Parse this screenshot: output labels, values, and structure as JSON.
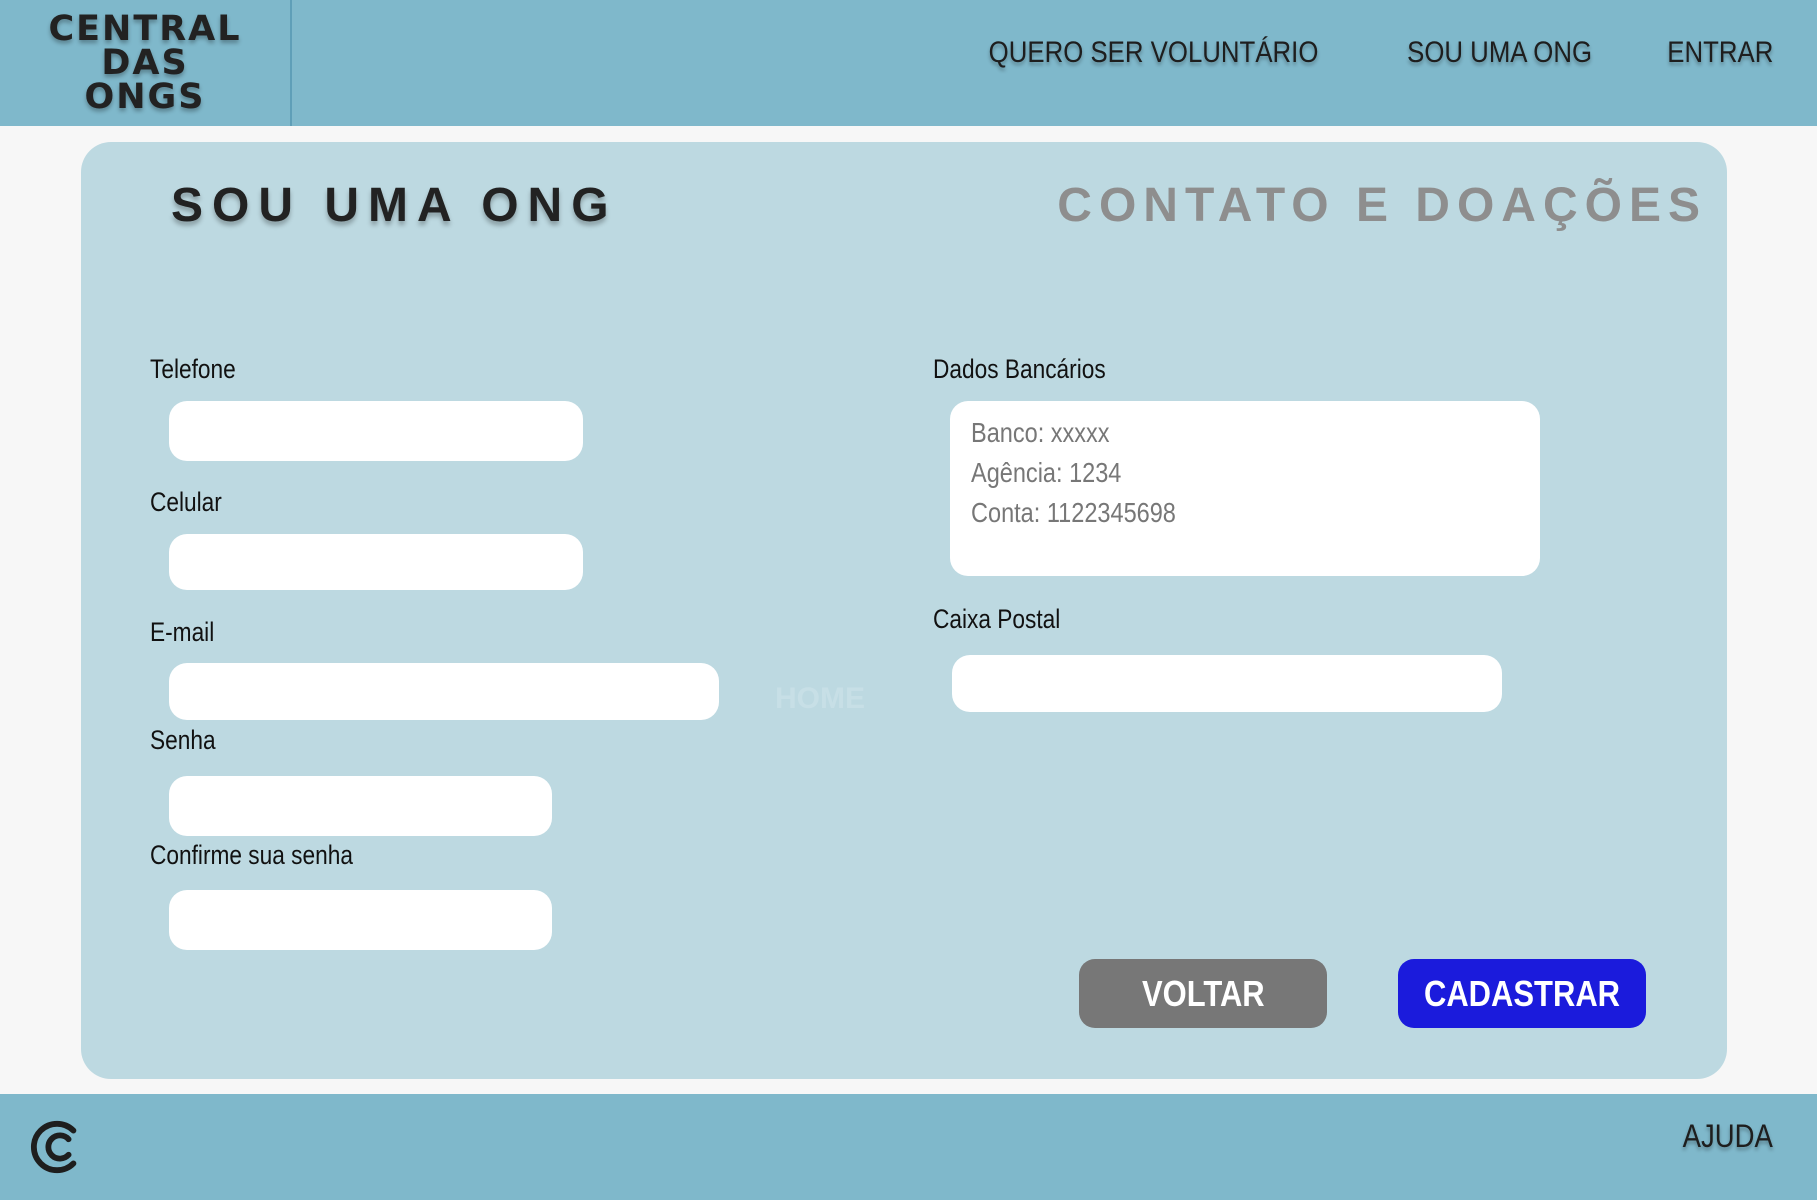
{
  "brand": {
    "logo_line1": "CENTRAL",
    "logo_line2": "DAS",
    "logo_line3": "ONGS"
  },
  "nav": {
    "volunteer": "QUERO SER VOLUNTÁRIO",
    "ngo": "SOU UMA ONG",
    "login": "ENTRAR"
  },
  "tabs": {
    "active": "SOU UMA ONG",
    "inactive": "CONTATO E DOAÇÕES"
  },
  "form": {
    "telefone_label": "Telefone",
    "celular_label": "Celular",
    "email_label": "E-mail",
    "senha_label": "Senha",
    "confirm_label": "Confirme sua senha",
    "bank_label": "Dados Bancários",
    "bank_line1": "Banco: xxxxx",
    "bank_line2": "Agência: 1234",
    "bank_line3": "Conta: 1122345698",
    "postal_label": "Caixa Postal",
    "ghost_text": "HOME"
  },
  "buttons": {
    "back": "VOLTAR",
    "submit": "CADASTRAR"
  },
  "footer": {
    "logo_icon": "c-logo-icon",
    "help": "AJUDA"
  },
  "colors": {
    "header_bg": "#7fb8cb",
    "card_bg": "#bdd9e1",
    "submit": "#1b1bdc",
    "back": "#777777"
  }
}
